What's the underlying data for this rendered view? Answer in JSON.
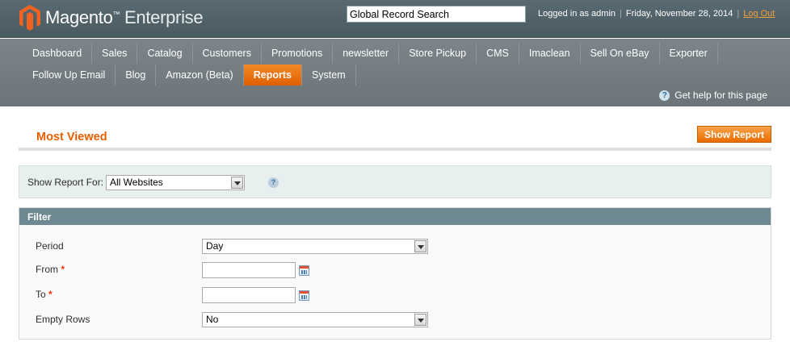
{
  "header": {
    "logo_brand": "Magento",
    "logo_tm": "™",
    "logo_edition": "Enterprise",
    "search_value": "Global Record Search",
    "logged_in": "Logged in as admin",
    "date": "Friday, November 28, 2014",
    "logout": "Log Out",
    "separator": "|"
  },
  "nav": {
    "row1": [
      "Dashboard",
      "Sales",
      "Catalog",
      "Customers",
      "Promotions",
      "newsletter",
      "Store Pickup",
      "CMS",
      "Imaclean",
      "Sell On eBay",
      "Exporter"
    ],
    "row2": [
      "Follow Up Email",
      "Blog",
      "Amazon (Beta)",
      "Reports",
      "System"
    ],
    "active": "Reports",
    "help": "Get help for this page"
  },
  "page": {
    "title": "Most Viewed",
    "show_report": "Show Report",
    "store_label": "Show Report For:",
    "store_value": "All Websites"
  },
  "filter": {
    "title": "Filter",
    "period_label": "Period",
    "period_value": "Day",
    "from_label": "From",
    "to_label": "To",
    "required_mark": "*",
    "empty_rows_label": "Empty Rows",
    "empty_rows_value": "No"
  },
  "colors": {
    "accent": "#eb5e00",
    "header_bg": "#4a5a61",
    "filter_head": "#6f8992"
  }
}
